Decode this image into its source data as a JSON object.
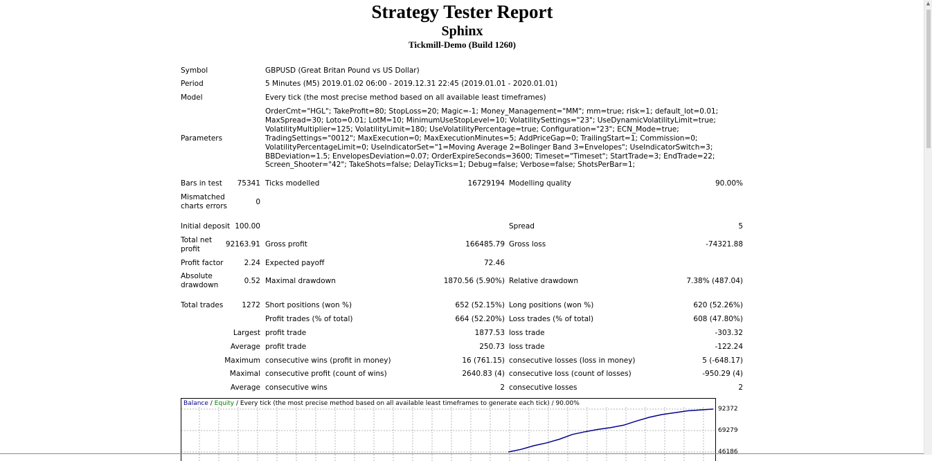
{
  "header": {
    "title": "Strategy Tester Report",
    "ea_name": "Sphinx",
    "server": "Tickmill-Demo (Build 1260)"
  },
  "info": {
    "symbol_label": "Symbol",
    "symbol_value": "GBPUSD (Great Britan Pound vs US Dollar)",
    "period_label": "Period",
    "period_value": "5 Minutes (M5) 2019.01.02 06:00 - 2019.12.31 22:45 (2019.01.01 - 2020.01.01)",
    "model_label": "Model",
    "model_value": "Every tick (the most precise method based on all available least timeframes)",
    "parameters_label": "Parameters",
    "parameters_value": "OrderCmt=\"HGL\"; TakeProfit=80; StopLoss=20; Magic=-1; Money_Management=\"MM\"; mm=true; risk=1; default_lot=0.01; MaxSpread=30; Loto=0.01; LotM=10; MinimumUseStopLevel=10; VolatilitySettings=\"23\"; UseDynamicVolatilityLimit=true; VolatilityMultiplier=125; VolatilityLimit=180; UseVolatilityPercentage=true; Configuration=\"23\"; ECN_Mode=true; TradingSettings=\"0012\"; MaxExecution=0; MaxExecutionMinutes=5; AddPriceGap=0; TrailingStart=1; Commission=0; VolatilityPercentageLimit=0; UseIndicatorSet=\"1=Moving Average 2=Bolinger Band 3=Envelopes\"; UseIndicatorSwitch=3; BBDeviation=1.5; EnvelopesDeviation=0.07; OrderExpireSeconds=3600; Timeset=\"Timeset\"; StartTrade=3; EndTrade=22; Screen_Shooter=\"42\"; TakeShots=false; DelayTicks=1; Debug=false; Verbose=false; ShotsPerBar=1;"
  },
  "stats": {
    "bars_label": "Bars in test",
    "bars_value": "75341",
    "ticks_label": "Ticks modelled",
    "ticks_value": "16729194",
    "quality_label": "Modelling quality",
    "quality_value": "90.00%",
    "mismatch_label_1": "Mismatched",
    "mismatch_label_2": "charts errors",
    "mismatch_value": "0",
    "deposit_label": "Initial deposit",
    "deposit_value": "100.00",
    "spread_label": "Spread",
    "spread_value": "5",
    "netprofit_label_1": "Total net",
    "netprofit_label_2": "profit",
    "netprofit_value": "92163.91",
    "grossprofit_label": "Gross profit",
    "grossprofit_value": "166485.79",
    "grossloss_label": "Gross loss",
    "grossloss_value": "-74321.88",
    "pf_label": "Profit factor",
    "pf_value": "2.24",
    "payoff_label": "Expected payoff",
    "payoff_value": "72.46",
    "absdd_label_1": "Absolute",
    "absdd_label_2": "drawdown",
    "absdd_value": "0.52",
    "maxdd_label": "Maximal drawdown",
    "maxdd_value": "1870.56 (5.90%)",
    "reldd_label": "Relative drawdown",
    "reldd_value": "7.38% (487.04)",
    "trades_label": "Total trades",
    "trades_value": "1272",
    "short_label": "Short positions (won %)",
    "short_value": "652 (52.15%)",
    "long_label": "Long positions (won %)",
    "long_value": "620 (52.26%)",
    "profit_trades_label": "Profit trades (% of total)",
    "profit_trades_value": "664 (52.20%)",
    "loss_trades_label": "Loss trades (% of total)",
    "loss_trades_value": "608 (47.80%)",
    "largest_label": "Largest",
    "largest_profit_label": "profit trade",
    "largest_profit_value": "1877.53",
    "largest_loss_label": "loss trade",
    "largest_loss_value": "-303.32",
    "average_label": "Average",
    "average_profit_label": "profit trade",
    "average_profit_value": "250.73",
    "average_loss_label": "loss trade",
    "average_loss_value": "-122.24",
    "maximum_label": "Maximum",
    "max_wins_label": "consecutive wins (profit in money)",
    "max_wins_value": "16 (761.15)",
    "max_losses_label": "consecutive losses (loss in money)",
    "max_losses_value": "5 (-648.17)",
    "maximal_label": "Maximal",
    "maximal_profit_label": "consecutive profit (count of wins)",
    "maximal_profit_value": "2640.83 (4)",
    "maximal_loss_label": "consecutive loss (count of losses)",
    "maximal_loss_value": "-950.29 (4)",
    "avg2_label": "Average",
    "avg_wins_label": "consecutive wins",
    "avg_wins_value": "2",
    "avg_losses_label": "consecutive losses",
    "avg_losses_value": "2"
  },
  "chart": {
    "legend_balance": "Balance",
    "legend_sep1": " / ",
    "legend_equity": "Equity",
    "legend_rest": " / Every tick (the most precise method based on all available least timeframes to generate each tick) / 90.00%",
    "balance_color": "#00008b",
    "equity_color": "#008000"
  },
  "chart_data": {
    "type": "line",
    "title": "",
    "xlabel": "",
    "ylabel": "",
    "y_ticks": [
      "92372",
      "69279",
      "46186"
    ],
    "series": [
      {
        "name": "Balance",
        "values": [
          46186,
          49000,
          53000,
          56000,
          60000,
          65000,
          68000,
          70500,
          72500,
          75000,
          79500,
          83500,
          86500,
          88500,
          90500,
          91500,
          92372
        ]
      }
    ]
  }
}
